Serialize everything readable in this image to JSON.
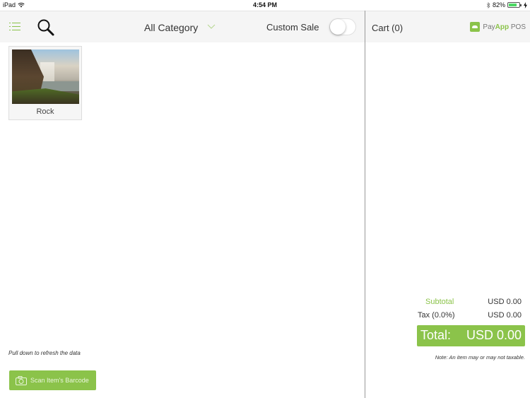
{
  "status_bar": {
    "device": "iPad",
    "time": "4:54 PM",
    "battery_percent": "82%",
    "battery_level": 0.82,
    "icons": [
      "wifi-icon",
      "bluetooth-icon",
      "battery-icon",
      "charging-icon"
    ]
  },
  "toolbar": {
    "menu_icon": "menu-icon",
    "search_icon": "search-icon",
    "category_selected": "All Category",
    "custom_sale_label": "Custom Sale",
    "custom_sale_on": false
  },
  "cart": {
    "title": "Cart (0)",
    "brand": {
      "pay": "Pay",
      "app": "App",
      "pos": " POS"
    },
    "subtotal_label": "Subtotal",
    "subtotal_value": "USD 0.00",
    "tax_label": "Tax (0.0%)",
    "tax_value": "USD 0.00",
    "total_label": "Total:",
    "total_value": "USD 0.00",
    "note": "Note: An item may or may not taxable."
  },
  "items": [
    {
      "name": "Rock",
      "image": "waterfall-photo"
    }
  ],
  "footer": {
    "pull_hint": "Pull down to refresh the data",
    "scan_button": "Scan Item's Barcode"
  },
  "colors": {
    "accent": "#8bc34a",
    "header_bg": "#f5f5f5",
    "divider": "#999999"
  }
}
